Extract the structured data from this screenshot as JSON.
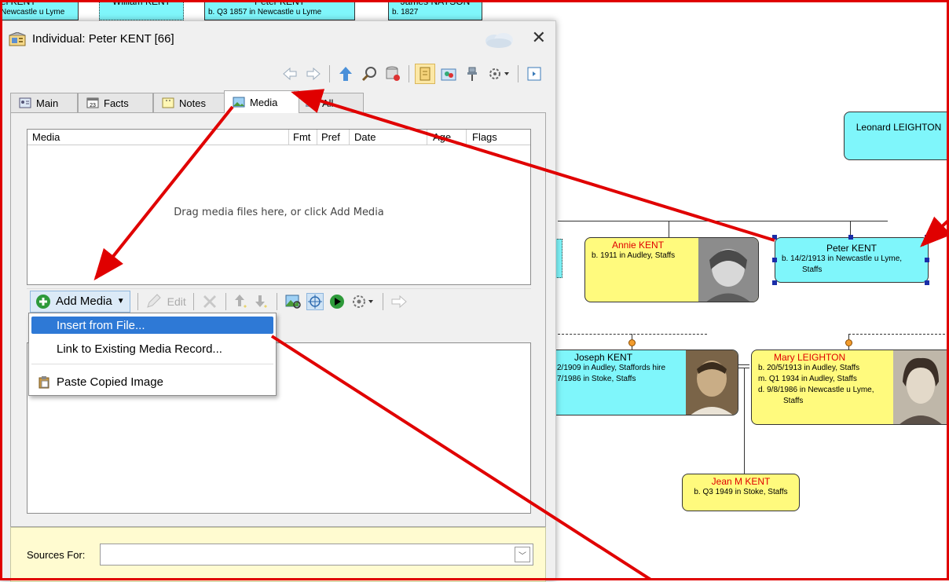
{
  "top_strip": [
    "el KENT",
    "William KENT",
    "Peter KENT",
    "James NAYSON"
  ],
  "top_strip_details": [
    "Newcastle u Lyme",
    "b. Q3 1857 in Newcastle u Lyme",
    "b. 1827"
  ],
  "chart": {
    "leonard": {
      "name": "Leonard LEIGHTON"
    },
    "annie": {
      "name": "Annie KENT",
      "detail": "b. 1911 in Audley, Staffs"
    },
    "peter": {
      "name": "Peter KENT",
      "detail1": "b. 14/2/1913 in Newcastle u Lyme,",
      "detail2": "Staffs"
    },
    "joseph": {
      "name": "Joseph KENT",
      "detail1": "2/1909 in Audley, Staffords hire",
      "detail2": "7/1986 in Stoke, Staffs"
    },
    "mary": {
      "name": "Mary LEIGHTON",
      "detail1": "b. 20/5/1913 in Audley, Staffs",
      "detail2": "m. Q1 1934 in Audley, Staffs",
      "detail3": "d. 9/8/1986 in Newcastle u Lyme,",
      "detail4": "Staffs"
    },
    "jean": {
      "name": "Jean M KENT",
      "detail": "b. Q3 1949 in Stoke, Staffs"
    }
  },
  "dialog": {
    "title": "Individual: Peter KENT [66]",
    "close": "✕",
    "tabs": [
      {
        "label": "Main"
      },
      {
        "label": "Facts"
      },
      {
        "label": "Notes"
      },
      {
        "label": "Media"
      },
      {
        "label": "All"
      }
    ],
    "facts_icon_num": "23",
    "grid": {
      "columns": [
        "Media",
        "Fmt",
        "Pref",
        "Date",
        "Age",
        "Flags"
      ],
      "empty_hint": "Drag media files here, or click Add Media"
    },
    "media_toolbar": {
      "add_media": "Add Media",
      "edit": "Edit"
    },
    "menu": {
      "items": [
        "Insert from File...",
        "Link to Existing Media Record...",
        "Paste Copied Image"
      ]
    },
    "sources": {
      "label": "Sources For:",
      "value": ""
    }
  },
  "colors": {
    "annotation_arrow": "#e00000",
    "menu_selected": "#2e79d6",
    "chart_cyan": "#7ff6fb",
    "chart_yellow": "#fffa7d",
    "name_red": "#e00000"
  }
}
